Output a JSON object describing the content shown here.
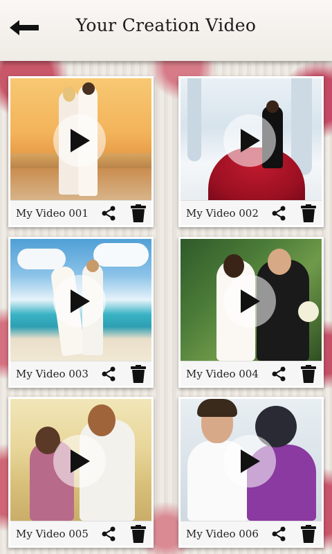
{
  "header": {
    "title": "Your Creation Video",
    "back_icon": "arrow-left-icon"
  },
  "videos": [
    {
      "label": "My Video 001",
      "scene": "sunset-beach"
    },
    {
      "label": "My Video 002",
      "scene": "ice-cave"
    },
    {
      "label": "My Video 003",
      "scene": "tropical-beach"
    },
    {
      "label": "My Video 004",
      "scene": "garden"
    },
    {
      "label": "My Video 005",
      "scene": "sunny-field"
    },
    {
      "label": "My Video 006",
      "scene": "indoor"
    }
  ],
  "icons": {
    "play": "play-icon",
    "share": "share-icon",
    "delete": "trash-icon"
  },
  "colors": {
    "header_bg": "#f4f1ec",
    "title_text": "#1b1b1b",
    "card_bar": "#f6f6f6",
    "icon": "#111111"
  }
}
